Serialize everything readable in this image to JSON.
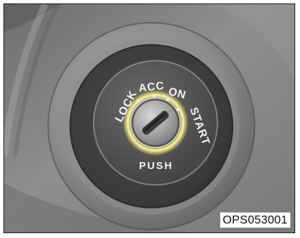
{
  "ignition_switch": {
    "positions": {
      "lock": "LOCK",
      "acc": "ACC",
      "on": "ON",
      "start": "START"
    },
    "push_label": "PUSH",
    "ring_glow_color": "#f2ec8a",
    "key_slot_icon": "key-slot-icon"
  },
  "figure_code": "OPS053001"
}
